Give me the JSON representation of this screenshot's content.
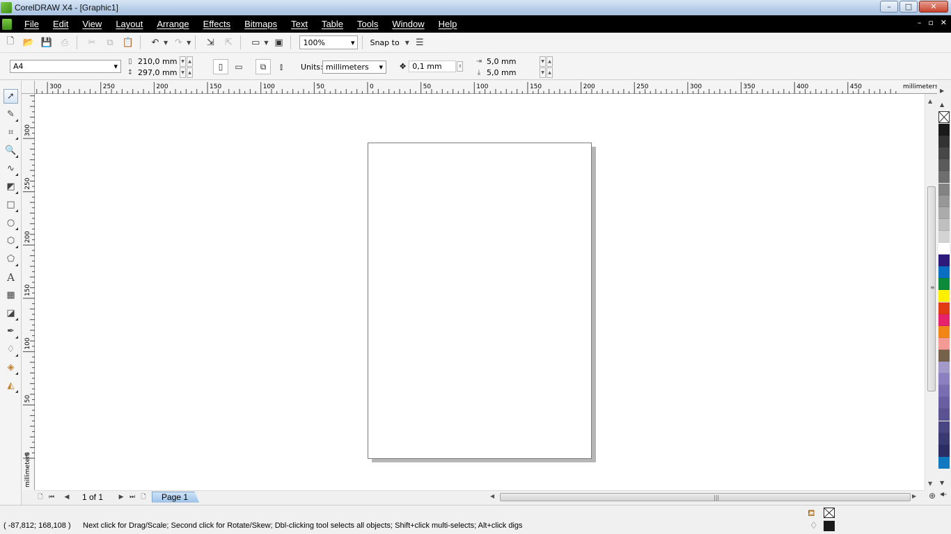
{
  "window": {
    "title": "CorelDRAW X4 - [Graphic1]",
    "controls": [
      "–",
      "□",
      "✕"
    ]
  },
  "menu": {
    "items": [
      "File",
      "Edit",
      "View",
      "Layout",
      "Arrange",
      "Effects",
      "Bitmaps",
      "Text",
      "Table",
      "Tools",
      "Window",
      "Help"
    ],
    "doc_controls": [
      "–",
      "▫",
      "✕"
    ]
  },
  "standard_toolbar": {
    "zoom_level": "100%",
    "snap_label": "Snap to"
  },
  "property_bar": {
    "paper_size": "A4",
    "width": "210,0 mm",
    "height": "297,0 mm",
    "units_label": "Units:",
    "units_value": "millimeters",
    "nudge": "0,1 mm",
    "dup_x": "5,0 mm",
    "dup_y": "5,0 mm"
  },
  "rulers": {
    "unit_label": "millimeters",
    "h_ticks": [
      "300",
      "250",
      "200",
      "150",
      "100",
      "50",
      "0",
      "50",
      "100",
      "150",
      "200",
      "250",
      "300",
      "350",
      "400",
      "450"
    ],
    "v_ticks": [
      "300",
      "250",
      "200",
      "150",
      "100",
      "50",
      "0"
    ]
  },
  "navigator": {
    "page_count": "1 of 1",
    "page_tab": "Page 1"
  },
  "status": {
    "coords": "( -87,812; 168,108 )",
    "hint": "Next click for Drag/Scale; Second click for Rotate/Skew; Dbl-clicking tool selects all objects; Shift+click multi-selects; Alt+click digs"
  },
  "palette": {
    "colors": [
      "#1a1a1a",
      "#333333",
      "#474747",
      "#5b5b5b",
      "#6f6f6f",
      "#838383",
      "#979797",
      "#ababab",
      "#bfbfbf",
      "#d3d3d3",
      "#ffffff",
      "#2e1a7a",
      "#0a6fc2",
      "#0c8a3a",
      "#ffef00",
      "#e23a12",
      "#e5226b",
      "#f18515",
      "#f49a94",
      "#76614a",
      "#a49ac9",
      "#8c80c0",
      "#7a6db2",
      "#6a5ea2",
      "#5a5292",
      "#4a4682",
      "#3a3a72",
      "#2a2e62",
      "#1378c2"
    ]
  }
}
